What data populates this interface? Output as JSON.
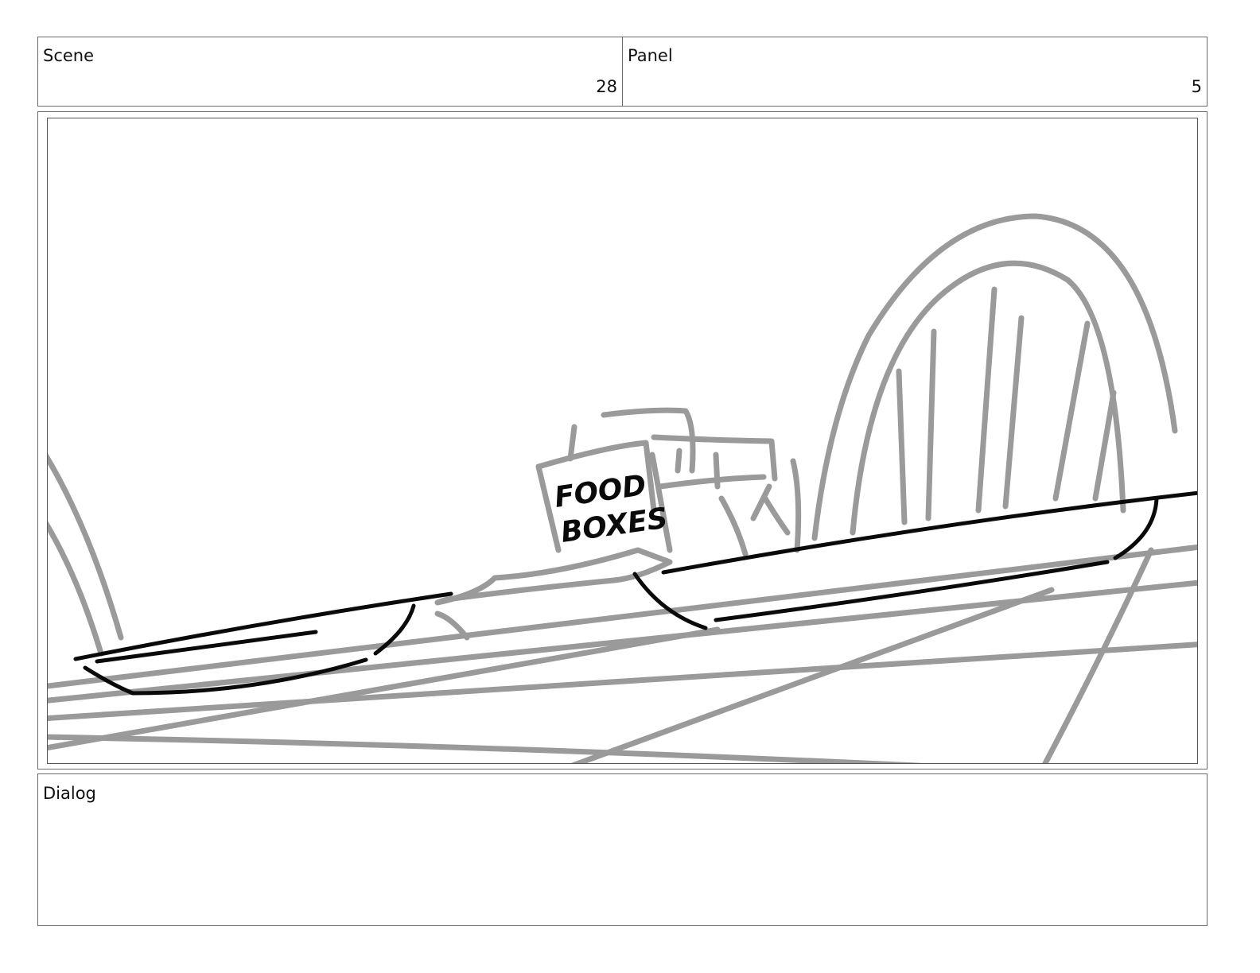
{
  "header": {
    "scene_label": "Scene",
    "scene_number": "28",
    "panel_label": "Panel",
    "panel_number": "5"
  },
  "panel": {
    "sign_line_1": "FOOD",
    "sign_line_2": "BOXES",
    "colors": {
      "rough": "#9a9a9a",
      "ink": "#0a0a0a"
    }
  },
  "dialog": {
    "label": "Dialog",
    "text": ""
  }
}
